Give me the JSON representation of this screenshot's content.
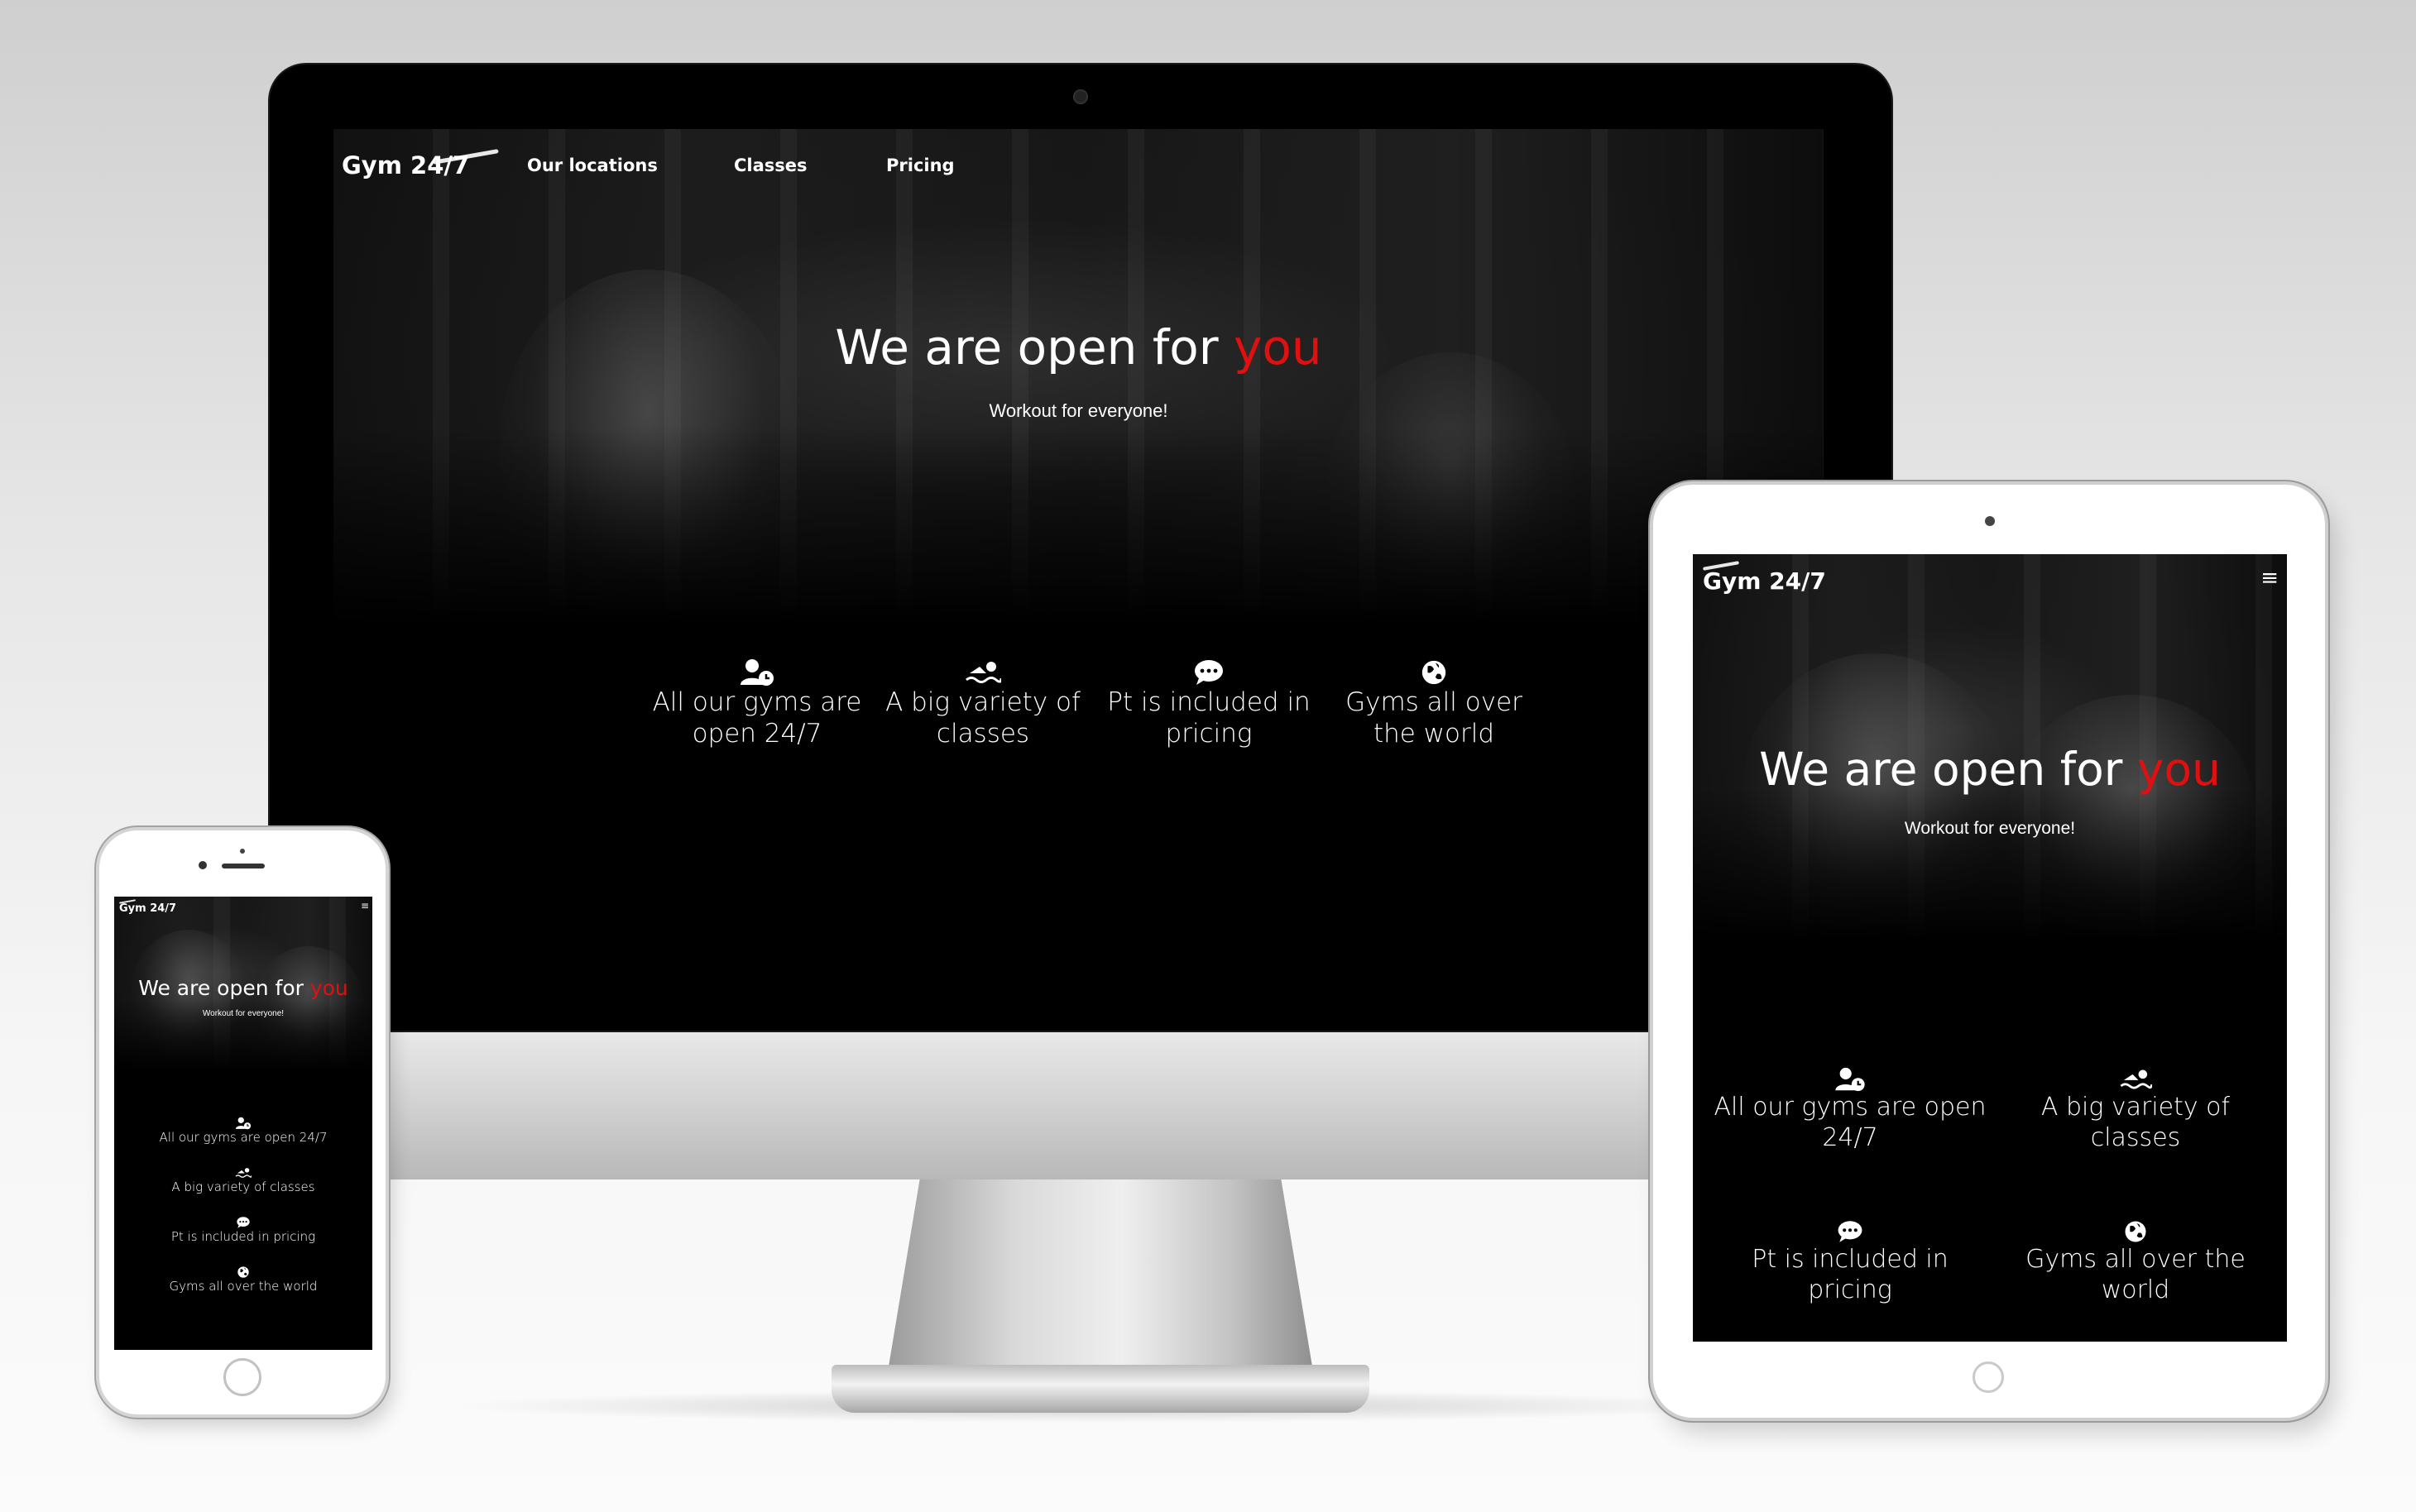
{
  "site": {
    "logo": "Gym 24/7",
    "nav": [
      "Our locations",
      "Classes",
      "Pricing"
    ],
    "menu_icon": "hamburger-menu-icon",
    "hero_title": "We are open for",
    "hero_title_accent": "you",
    "hero_subtitle": "Workout for everyone!",
    "accent_color": "#e01010",
    "background_color": "#000000",
    "features": [
      {
        "icon": "user-clock-icon",
        "desktop_lines": [
          "All our gyms are",
          "open 24/7"
        ],
        "tablet_lines": [
          "All our gyms are open",
          "24/7"
        ],
        "phone_text": "All our gyms are open 24/7"
      },
      {
        "icon": "swimmer-icon",
        "desktop_lines": [
          "A big variety of",
          "classes"
        ],
        "tablet_lines": [
          "A big variety of",
          "classes"
        ],
        "phone_text": "A big variety of classes"
      },
      {
        "icon": "comment-icon",
        "desktop_lines": [
          "Pt is included in",
          "pricing"
        ],
        "tablet_lines": [
          "Pt is included in",
          "pricing"
        ],
        "phone_text": "Pt is included in pricing"
      },
      {
        "icon": "globe-icon",
        "desktop_lines": [
          "Gyms all over",
          "the world"
        ],
        "tablet_lines": [
          "Gyms all over the",
          "world"
        ],
        "phone_text": "Gyms all over the world"
      }
    ]
  },
  "devices": [
    "desktop-monitor",
    "tablet",
    "phone"
  ]
}
